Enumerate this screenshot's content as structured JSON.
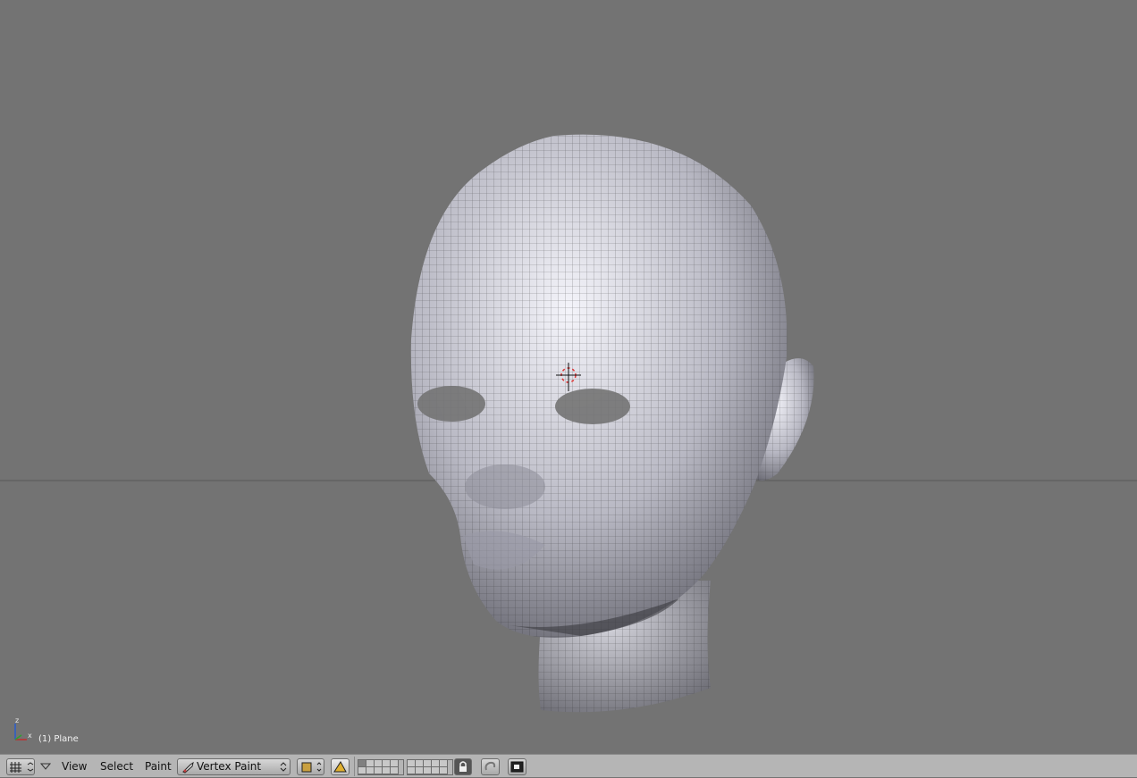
{
  "viewport": {
    "object_label": "(1) Plane",
    "axis_labels": {
      "z": "z",
      "x": "x"
    }
  },
  "header": {
    "editor_type_icon": "grid-editor-icon",
    "menus": [
      "View",
      "Select",
      "Paint"
    ],
    "mode_label": "Vertex Paint",
    "colors": {
      "header_bg": "#b5b5b5",
      "viewport_bg": "#737373"
    }
  }
}
